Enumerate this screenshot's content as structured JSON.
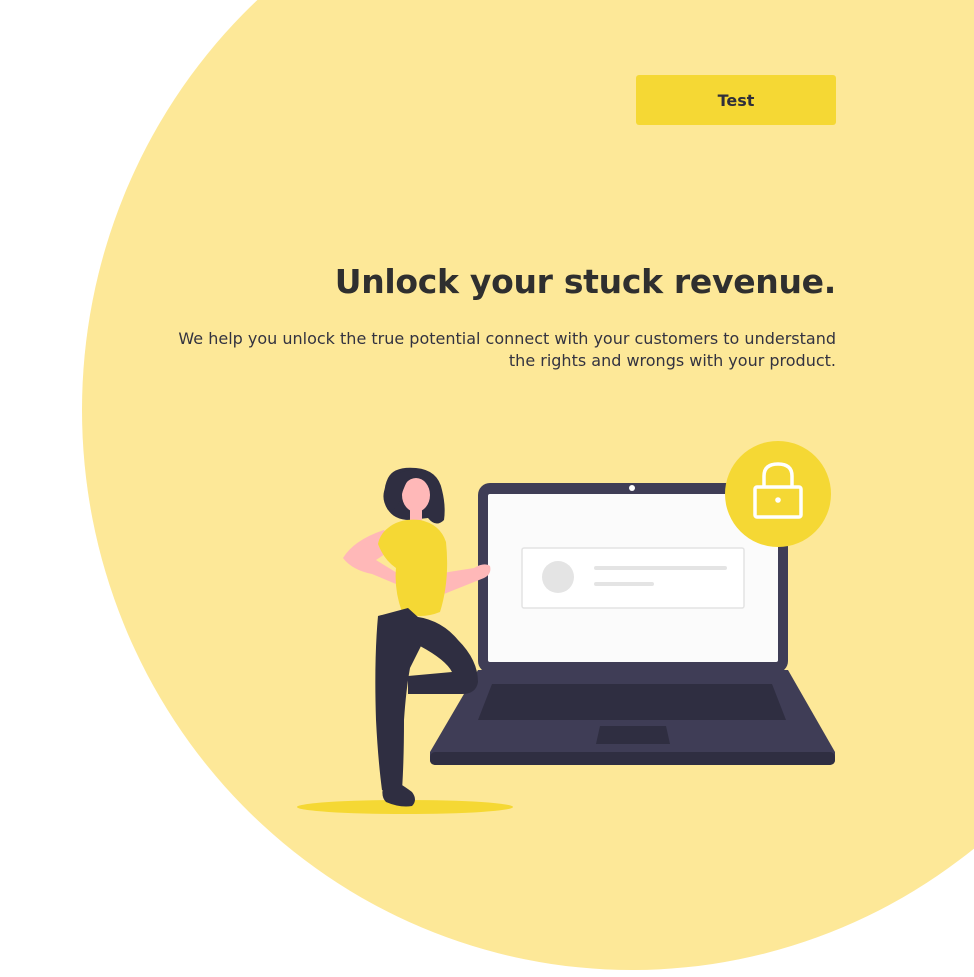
{
  "cta": {
    "test_label": "Test"
  },
  "hero": {
    "title": "Unlock your stuck revenue.",
    "description": "We help you unlock the true potential connect with your customers to understand the rights and wrongs with your product."
  },
  "illustration": {
    "icons": [
      "lock-icon",
      "avatar-placeholder-icon"
    ]
  },
  "colors": {
    "background_blob": "#fde898",
    "accent_yellow": "#f5d834",
    "dark_navy": "#3f3d56",
    "text_dark": "#2f2f2f"
  }
}
